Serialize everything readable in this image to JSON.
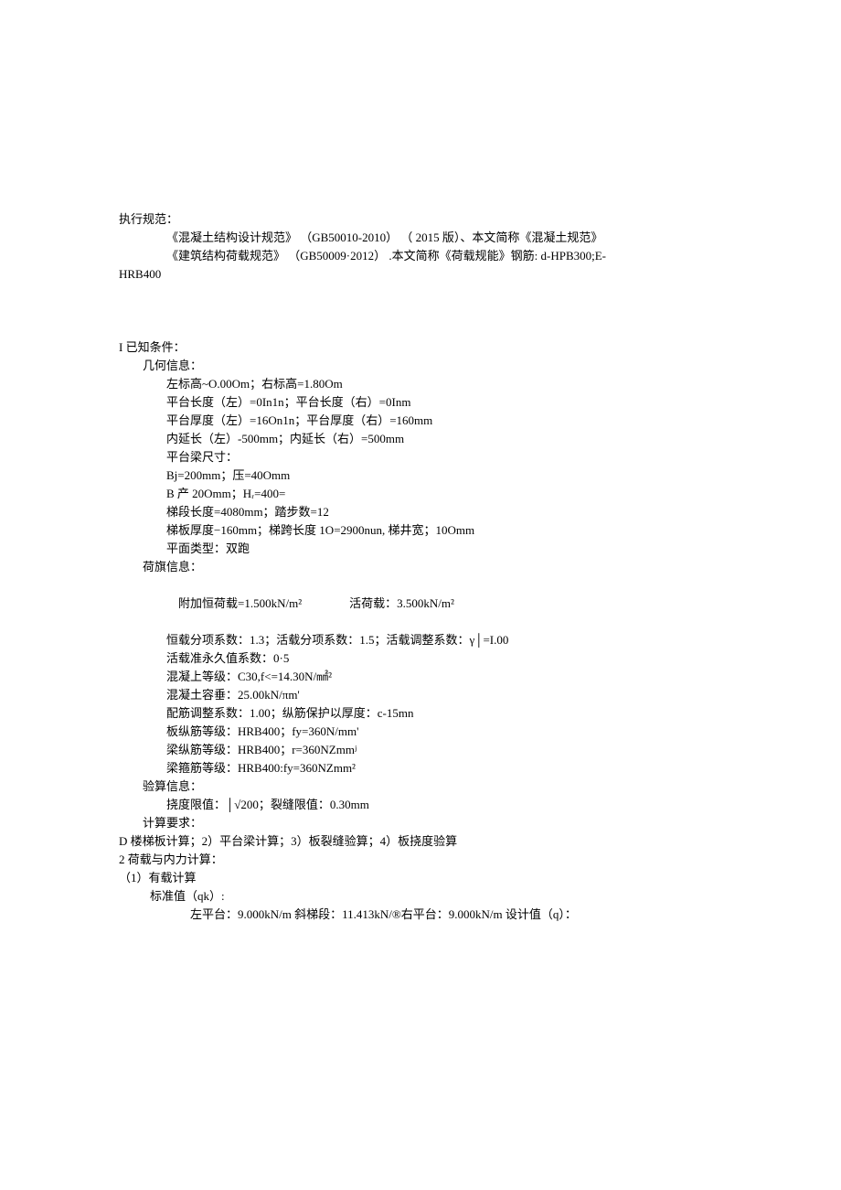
{
  "header": {
    "l1": "执行规范：",
    "l2": "《混凝土结构设计规范》 （GB50010-2010） （ 2015 版）、本文简称《混凝土规范》",
    "l3": "《建筑结构荷载规范》 （GB50009·2012） .本文简称《荷载规能》钢筋: d-HPB300;E-",
    "l4": "HRB400"
  },
  "section1": {
    "title": "I 已知条件：",
    "geo_title": "几何信息：",
    "g1": "左标高~O.00Om；右标高=1.80Om",
    "g2": "平台长度（左）=0In1n；平台长度（右）=0Inm",
    "g3": "平台厚度（左）=16On1n；平台厚度（右）=160mm",
    "g4": "内延长（左）-500mm；内延长（右）=500mm",
    "g5": "平台梁尺寸：",
    "g6": "Bj=200mm；压=40Omm",
    "g7": "B 产 20Omm；Hᵣ=400=",
    "g8": "梯段长度=4080mm；踏步数=12",
    "g9": "梯板厚度−160mm；梯跨长度 1O=2900nun, 梯井宽；10Omm",
    "g10": "平面类型：双跑",
    "load_title": "荷旗信息：",
    "lo1_a": "附加恒荷载=1.500kN/m²",
    "lo1_b": "活荷载：3.500kN/m²",
    "lo2": "恒载分项系数：1.3；活载分项系数：1.5；活载调整系数：γ│=I.00",
    "lo3": "活载准永久值系数：0·5",
    "lo4": "混凝上等级：C30,f<=14.30N/㎟²",
    "lo5": "混凝土容垂：25.00kN/πm'",
    "lo6": "配筋调整系数：1.00；纵筋保护以厚度：c-15mn",
    "lo7": "板纵筋等级：HRB400；fy=360N/mm'",
    "lo8": "梁纵筋等级：HRB400；r=360NZmmʲ",
    "lo9": "梁箍筋等级：HRB400:fy=360NZmm²",
    "check_title": "验算信息：",
    "c1": "挠度限值：│√200；裂缝限值：0.30mm",
    "calc_req": "计算要求：",
    "calc_req_line": "D 楼梯板计算；2）平台梁计算；3）板裂缝验算；4）板挠度验算"
  },
  "section2": {
    "title": "2 荷载与内力计算：",
    "sub1": "（1）有载计算",
    "s1": "标准值（qk）:",
    "s2": "左平台：9.000kN/m 斜梯段：11.413kN/®右平台：9.000kN/m 设计值（q）："
  }
}
